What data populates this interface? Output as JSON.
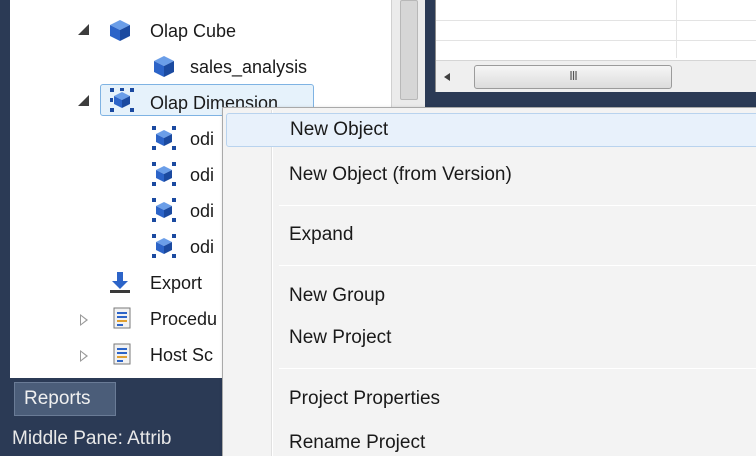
{
  "tree": {
    "items": [
      {
        "label": "Olap Cube"
      },
      {
        "label": "sales_analysis"
      },
      {
        "label": "Olap Dimension"
      },
      {
        "label": "odi"
      },
      {
        "label": "odi"
      },
      {
        "label": "odi"
      },
      {
        "label": "odi"
      },
      {
        "label": "Export"
      },
      {
        "label": "Procedu"
      },
      {
        "label": "Host Sc"
      }
    ]
  },
  "grid": {
    "scroll_grip": "III"
  },
  "bottom": {
    "tab_label": "Reports",
    "status_text": "Middle Pane: Attrib"
  },
  "context_menu": {
    "items": [
      {
        "label": "New Object"
      },
      {
        "label": "New Object (from Version)"
      },
      {
        "label": "Expand"
      },
      {
        "label": "New Group"
      },
      {
        "label": "New Project"
      },
      {
        "label": "Project Properties"
      },
      {
        "label": "Rename Project"
      }
    ]
  },
  "colors": {
    "background": "#2b3a55",
    "cube_icon": "#2c64c8",
    "menu_hover": "#e8f1fb",
    "selection": "#e6f2fb"
  }
}
